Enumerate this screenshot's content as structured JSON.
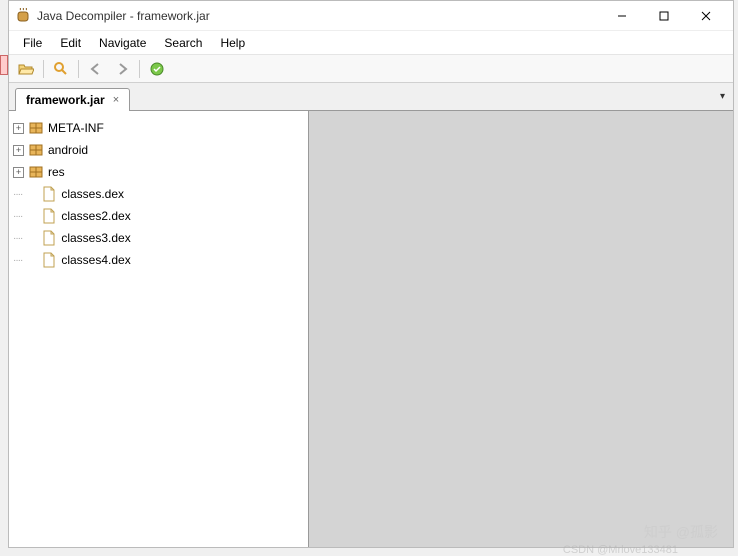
{
  "title": "Java Decompiler - framework.jar",
  "menu": {
    "file": "File",
    "edit": "Edit",
    "navigate": "Navigate",
    "search": "Search",
    "help": "Help"
  },
  "tab": {
    "label": "framework.jar",
    "close": "×"
  },
  "tree": {
    "items": [
      {
        "label": "META-INF",
        "type": "package",
        "expandable": true
      },
      {
        "label": "android",
        "type": "package",
        "expandable": true
      },
      {
        "label": "res",
        "type": "package",
        "expandable": true
      },
      {
        "label": "classes.dex",
        "type": "file",
        "expandable": false
      },
      {
        "label": "classes2.dex",
        "type": "file",
        "expandable": false
      },
      {
        "label": "classes3.dex",
        "type": "file",
        "expandable": false
      },
      {
        "label": "classes4.dex",
        "type": "file",
        "expandable": false
      }
    ]
  },
  "watermark": {
    "line1": "知乎 @孤影",
    "line2": "CSDN @Mrlove133481"
  }
}
